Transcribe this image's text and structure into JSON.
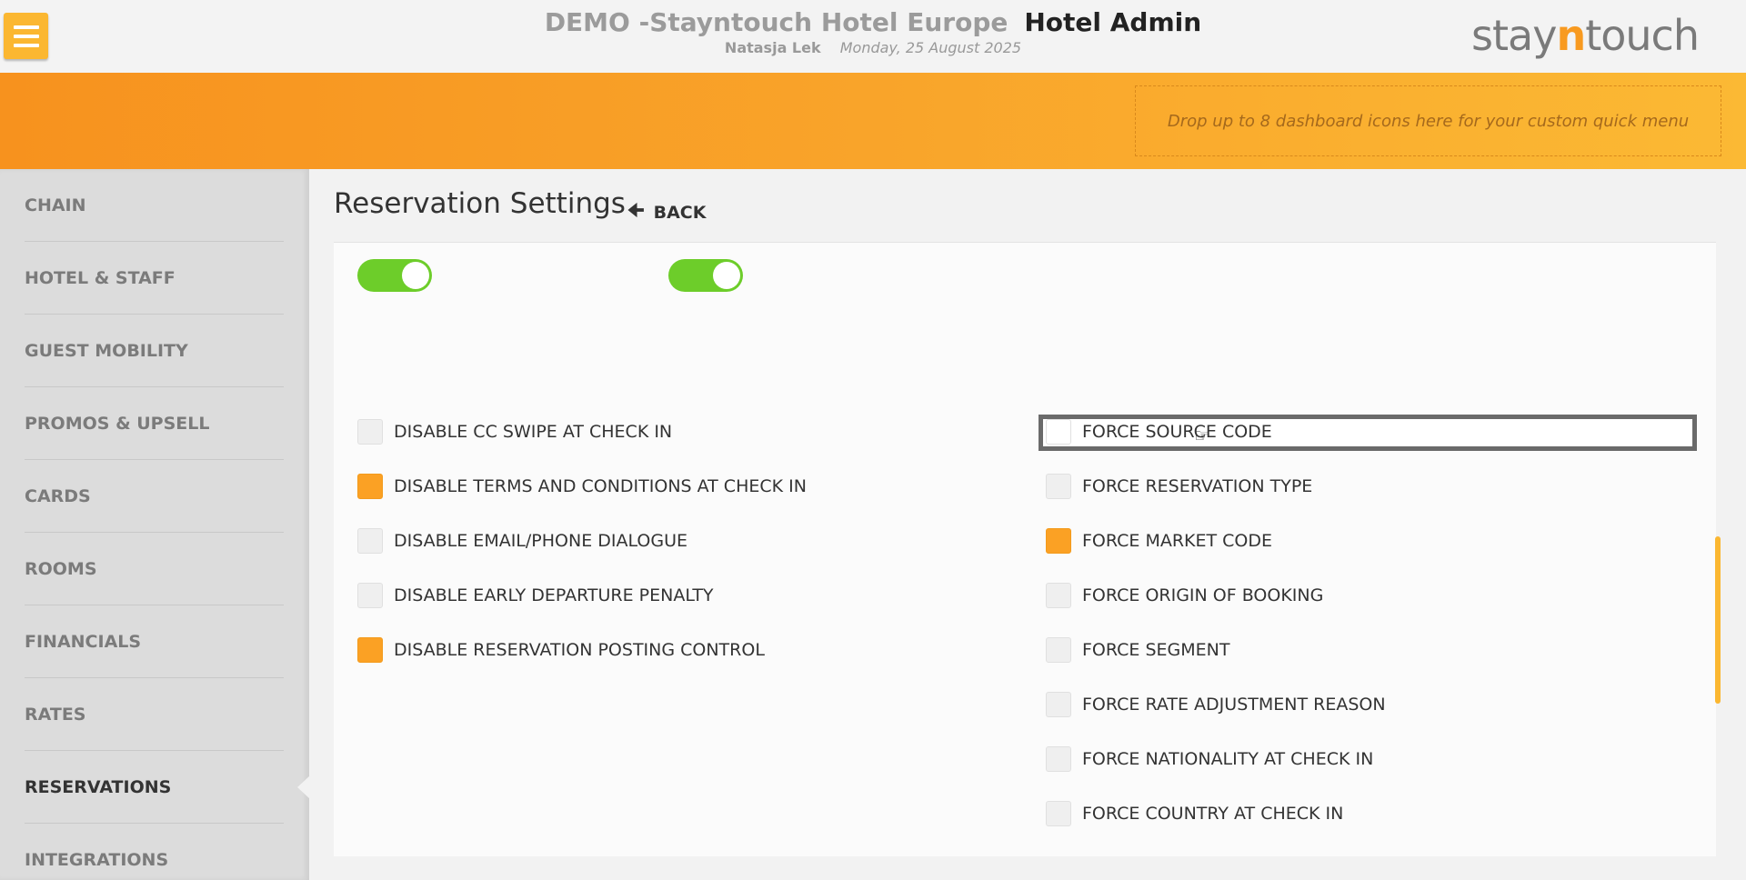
{
  "header": {
    "hotel_name": "DEMO -Stayntouch Hotel Europe",
    "app_title": "Hotel Admin",
    "user": "Natasja Lek",
    "date": "Monday, 25 August 2025",
    "logo_pre": "stay",
    "logo_accent": "n",
    "logo_post": "touch",
    "menu_icon": "hamburger-icon"
  },
  "banner": {
    "dropzone_text": "Drop up to 8 dashboard icons here for your custom quick menu"
  },
  "sidebar": {
    "items": [
      {
        "label": "CHAIN"
      },
      {
        "label": "HOTEL & STAFF"
      },
      {
        "label": "GUEST MOBILITY"
      },
      {
        "label": "PROMOS & UPSELL"
      },
      {
        "label": "CARDS"
      },
      {
        "label": "ROOMS"
      },
      {
        "label": "FINANCIALS"
      },
      {
        "label": "RATES"
      },
      {
        "label": "RESERVATIONS",
        "active": true
      },
      {
        "label": "INTEGRATIONS"
      }
    ]
  },
  "page": {
    "title": "Reservation Settings",
    "back_label": "BACK",
    "back_icon": "arrow-left-icon"
  },
  "toggles": [
    {
      "on": true
    },
    {
      "on": true
    }
  ],
  "left_options": [
    {
      "label": "DISABLE CC SWIPE AT CHECK IN",
      "checked": false
    },
    {
      "label": "DISABLE TERMS AND CONDITIONS AT CHECK IN",
      "checked": true
    },
    {
      "label": "DISABLE EMAIL/PHONE DIALOGUE",
      "checked": false
    },
    {
      "label": "DISABLE EARLY DEPARTURE PENALTY",
      "checked": false
    },
    {
      "label": "DISABLE RESERVATION POSTING CONTROL",
      "checked": true
    }
  ],
  "right_options": [
    {
      "label": "FORCE SOURCE CODE",
      "checked": false,
      "focused": true
    },
    {
      "label": "FORCE RESERVATION TYPE",
      "checked": false
    },
    {
      "label": "FORCE MARKET CODE",
      "checked": true
    },
    {
      "label": "FORCE ORIGIN OF BOOKING",
      "checked": false
    },
    {
      "label": "FORCE SEGMENT",
      "checked": false
    },
    {
      "label": "FORCE RATE ADJUSTMENT REASON",
      "checked": false
    },
    {
      "label": "FORCE NATIONALITY AT CHECK IN",
      "checked": false
    },
    {
      "label": "FORCE COUNTRY AT CHECK IN",
      "checked": false
    }
  ],
  "colors": {
    "accent": "#fba124",
    "toggle_on": "#6dcd2a",
    "banner_start": "#f7921e",
    "banner_end": "#fbb934"
  }
}
